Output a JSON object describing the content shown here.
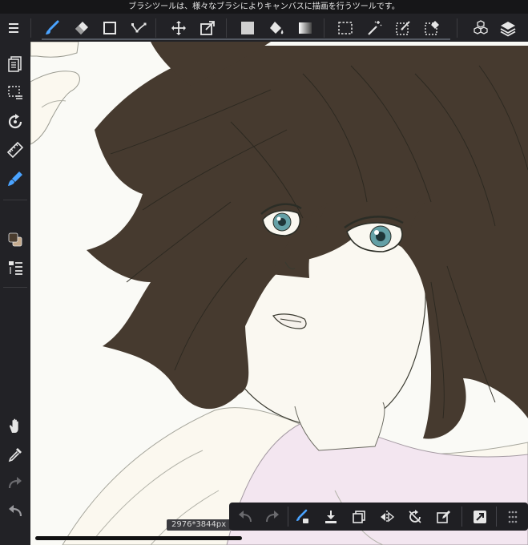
{
  "status_bar": {
    "hint_text": "ブラシツールは、様々なブラシによりキャンバスに描画を行うツールです。"
  },
  "top_toolbar": {
    "tools": [
      {
        "id": "menu",
        "icon": "hamburger-menu-icon",
        "active": false
      },
      {
        "id": "brush",
        "icon": "brush-icon",
        "active": true
      },
      {
        "id": "eraser",
        "icon": "eraser-icon",
        "active": false
      },
      {
        "id": "shape",
        "icon": "square-outline-icon",
        "active": false
      },
      {
        "id": "edit",
        "icon": "edit-points-icon",
        "active": false
      },
      {
        "id": "move",
        "icon": "move-arrows-icon",
        "active": false
      },
      {
        "id": "transform",
        "icon": "transform-icon",
        "active": false
      },
      {
        "id": "fill",
        "icon": "fill-rect-icon",
        "active": false
      },
      {
        "id": "bucket",
        "icon": "paint-bucket-icon",
        "active": false
      },
      {
        "id": "gradient",
        "icon": "gradient-icon",
        "active": false
      },
      {
        "id": "select",
        "icon": "marquee-select-icon",
        "active": false
      },
      {
        "id": "magic-wand",
        "icon": "magic-wand-icon",
        "active": false
      },
      {
        "id": "select-pen",
        "icon": "select-pen-icon",
        "active": false
      },
      {
        "id": "select-eraser",
        "icon": "select-eraser-icon",
        "active": false
      },
      {
        "id": "materials",
        "icon": "cubes-icon",
        "active": false
      },
      {
        "id": "layers",
        "icon": "layers-icon",
        "active": false
      }
    ]
  },
  "left_sidebar": {
    "tools": [
      {
        "id": "document",
        "icon": "document-icon"
      },
      {
        "id": "selection-list",
        "icon": "selection-list-icon"
      },
      {
        "id": "rotate",
        "icon": "rotate-icon"
      },
      {
        "id": "ruler",
        "icon": "ruler-icon"
      },
      {
        "id": "brush-settings",
        "icon": "brush-settings-icon"
      },
      {
        "id": "color",
        "icon": "color-swatch-icon"
      },
      {
        "id": "layer-list",
        "icon": "layer-list-icon"
      },
      {
        "id": "hand",
        "icon": "hand-icon"
      },
      {
        "id": "eyedropper",
        "icon": "eyedropper-icon"
      },
      {
        "id": "redo",
        "icon": "redo-icon"
      },
      {
        "id": "undo",
        "icon": "undo-icon"
      }
    ],
    "colors": {
      "foreground": "#4a3c2e",
      "background": "#c5ab8d"
    }
  },
  "canvas": {
    "size_label": "2976*3844px",
    "colors": {
      "paper": "#fafaf6",
      "hair": "#463a2f",
      "skin": "#faf8f1",
      "shirt": "#f3e6f0",
      "line": "#2b2d26",
      "eye": "#64a0a6"
    }
  },
  "bottom_bar": {
    "buttons": [
      {
        "id": "undo",
        "icon": "undo-icon",
        "enabled": false
      },
      {
        "id": "redo",
        "icon": "redo-icon",
        "enabled": false
      },
      {
        "id": "brush-eraser-toggle",
        "icon": "brush-swap-icon",
        "enabled": true
      },
      {
        "id": "save",
        "icon": "download-icon",
        "enabled": true
      },
      {
        "id": "duplicate",
        "icon": "copy-icon",
        "enabled": true
      },
      {
        "id": "flip",
        "icon": "flip-horizontal-icon",
        "enabled": true
      },
      {
        "id": "rotate-reset",
        "icon": "rotate-reset-icon",
        "enabled": true
      },
      {
        "id": "edit-selection",
        "icon": "edit-square-icon",
        "enabled": true
      },
      {
        "id": "fullscreen",
        "icon": "fullscreen-arrow-icon",
        "enabled": true
      },
      {
        "id": "more",
        "icon": "grip-dots-icon",
        "enabled": true
      }
    ]
  }
}
